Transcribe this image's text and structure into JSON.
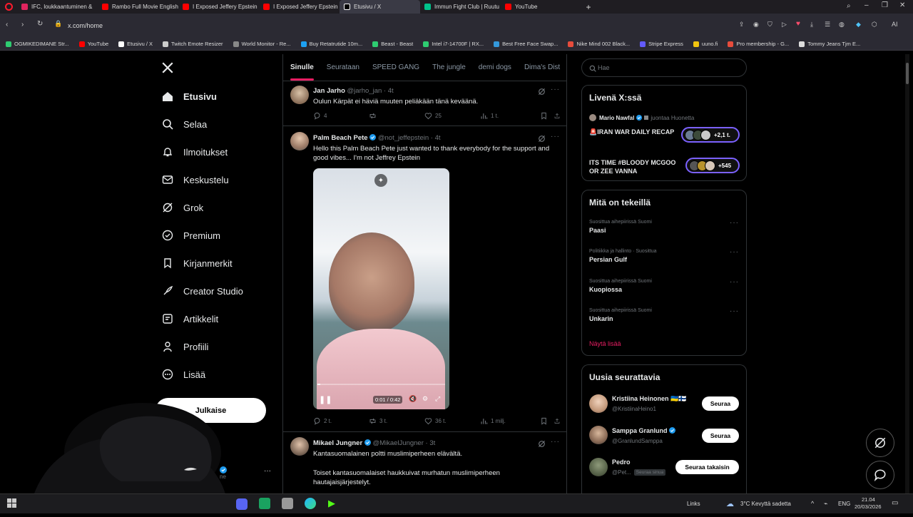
{
  "browser": {
    "tabs": [
      {
        "label": "IFC, loukkaantuminen & ",
        "color": "#e0245e"
      },
      {
        "label": "Rambo Full Movie English",
        "color": "#ff0000"
      },
      {
        "label": "I Exposed Jeffery Epstein",
        "color": "#ff0000"
      },
      {
        "label": "I Exposed Jeffery Epstein",
        "color": "#ff0000"
      },
      {
        "label": "Etusivu / X",
        "color": "#ffffff",
        "active": true
      },
      {
        "label": "Immun Fight Club | Ruutu",
        "color": "#00c28a"
      },
      {
        "label": "YouTube",
        "color": "#ff0000"
      }
    ],
    "url": "x.com/home",
    "bookmarks": [
      {
        "label": "OGMIKEDIMANE Str...",
        "color": "#2ecc71"
      },
      {
        "label": "YouTube",
        "color": "#ff0000"
      },
      {
        "label": "Etusivu / X",
        "color": "#ffffff"
      },
      {
        "label": "Twitch Emote Resizer",
        "color": "#cccccc"
      },
      {
        "label": "World Monitor - Re...",
        "color": "#888888"
      },
      {
        "label": "Buy Retatrutide 10m...",
        "color": "#1da1f2"
      },
      {
        "label": "Beast - Beast",
        "color": "#2ecc71"
      },
      {
        "label": "Intel i7-14700F | RX...",
        "color": "#2ecc71"
      },
      {
        "label": "Best Free Face Swap...",
        "color": "#3498db"
      },
      {
        "label": "Nike Mind 002 Black...",
        "color": "#e74c3c"
      },
      {
        "label": "Stripe Express",
        "color": "#635bff"
      },
      {
        "label": "uuno.fi",
        "color": "#f1c40f"
      },
      {
        "label": "Pro membership - G...",
        "color": "#e74c3c"
      },
      {
        "label": "Tommy Jeans Tjm E...",
        "color": "#dddddd"
      }
    ]
  },
  "nav": {
    "items": [
      {
        "label": "Etusivu",
        "icon": "home-icon"
      },
      {
        "label": "Selaa",
        "icon": "search-icon"
      },
      {
        "label": "Ilmoitukset",
        "icon": "bell-icon"
      },
      {
        "label": "Keskustelu",
        "icon": "mail-icon"
      },
      {
        "label": "Grok",
        "icon": "grok-icon"
      },
      {
        "label": "Premium",
        "icon": "premium-icon"
      },
      {
        "label": "Kirjanmerkit",
        "icon": "bookmark-icon"
      },
      {
        "label": "Creator Studio",
        "icon": "rocket-icon"
      },
      {
        "label": "Artikkelit",
        "icon": "article-icon"
      },
      {
        "label": "Profiili",
        "icon": "person-icon"
      },
      {
        "label": "Lisää",
        "icon": "more-circle-icon"
      }
    ],
    "post_button": "Julkaise",
    "account_handle": "ne"
  },
  "feed": {
    "tabs": [
      "Sinulle",
      "Seurataan",
      "SPEED GANG",
      "The jungle",
      "demi dogs",
      "Dima's Dist"
    ],
    "posts": [
      {
        "name": "Jan Jarho",
        "handle": "@jarho_jan",
        "time": "· 4t",
        "text": "Oulun Kärpät ei häviä muuten peliäkään tänä keväänä.",
        "replies": "4",
        "reposts": "",
        "likes": "25",
        "views": "1 t."
      },
      {
        "name": "Palm Beach Pete",
        "handle": "@not_jeffepstein",
        "time": "· 4t",
        "text": "Hello this Palm Beach Pete just wanted to thank everybody for the support and good vibes... I'm not Jeffrey Epstein",
        "video_time": "0:01 / 0:42",
        "replies": "2 t.",
        "reposts": "3 t.",
        "likes": "36 t.",
        "views": "1 milj."
      },
      {
        "name": "Mikael Jungner",
        "handle": "@MikaelJungner",
        "time": "· 3t",
        "text1": "Kantasuomalainen poltti muslimiperheen elävältä.",
        "text2": "Toiset kantasuomalaiset haukkuivat murhatun muslimiperheen hautajaisjärjestelyt."
      }
    ]
  },
  "right": {
    "search_placeholder": "Hae",
    "live": {
      "title": "Livenä X:ssä",
      "host_name": "Mario Nawfal",
      "host_sub": "juontaa Huonetta",
      "rooms": [
        {
          "title": "🚨IRAN WAR DAILY RECAP",
          "count": "+2,1 t."
        },
        {
          "title": "ITS TIME #BLOODY MCGOO OR ZEE VANNA",
          "count": "+545"
        }
      ]
    },
    "trends": {
      "title": "Mitä on tekeillä",
      "items": [
        {
          "meta": "Suosittua aihepiirissä Suomi",
          "name": "Paasi"
        },
        {
          "meta": "Politiikka ja hallinto · Suosittua",
          "name": "Persian Gulf"
        },
        {
          "meta": "Suosittua aihepiirissä Suomi",
          "name": "Kuopiossa"
        },
        {
          "meta": "Suosittua aihepiirissä Suomi",
          "name": "Unkarin"
        }
      ],
      "show_more": "Näytä lisää"
    },
    "who_to_follow": {
      "title": "Uusia seurattavia",
      "users": [
        {
          "name": "Kristiina Heinonen 🇺🇦🇫🇮",
          "handle": "@KristiinaHeino1",
          "button": "Seuraa"
        },
        {
          "name": "Samppa Granlund",
          "handle": "@GranlundSamppa",
          "button": "Seuraa"
        },
        {
          "name": "Pedro",
          "handle": "@Pet...",
          "badge": "Seuraa sinua",
          "button": "Seuraa takaisin"
        }
      ]
    }
  },
  "taskbar": {
    "links": "Links",
    "weather": "3°C  Kevyttä sadetta",
    "lang": "ENG",
    "time": "21.04",
    "date": "20/03/2026"
  },
  "colors": {
    "accent": "#e91e63",
    "verified": "#1d9bf0",
    "bg": "#000000"
  }
}
